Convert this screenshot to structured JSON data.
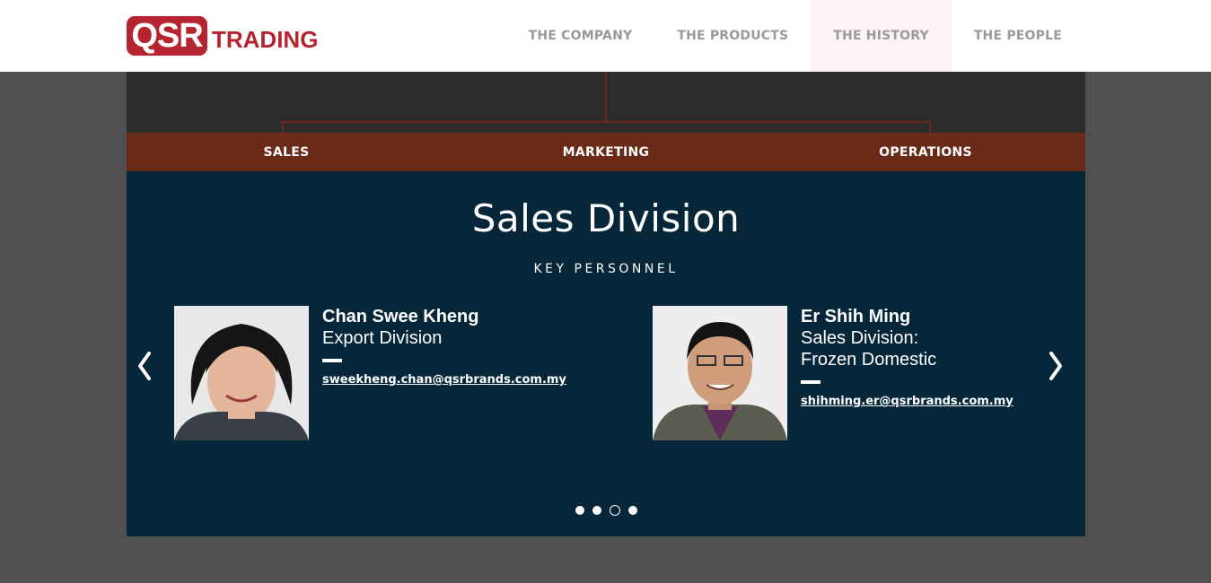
{
  "brand": {
    "logo_box": "QSR",
    "logo_text": "TRADING"
  },
  "nav": {
    "items": [
      {
        "label": "THE COMPANY"
      },
      {
        "label": "THE PRODUCTS"
      },
      {
        "label": "THE HISTORY"
      },
      {
        "label": "THE PEOPLE"
      }
    ]
  },
  "tabs": [
    {
      "label": "SALES"
    },
    {
      "label": "MARKETING"
    },
    {
      "label": "OPERATIONS"
    }
  ],
  "division": {
    "title": "Sales Division",
    "subtitle": "KEY PERSONNEL",
    "people": [
      {
        "name": "Chan Swee Kheng",
        "role": "Export Division",
        "email": "sweekheng.chan@qsrbrands.com.my"
      },
      {
        "name": "Er Shih Ming",
        "role": "Sales Division:\nFrozen Domestic",
        "email": "shihming.er@qsrbrands.com.my"
      }
    ]
  },
  "carousel": {
    "page_count": 4,
    "current_page": 3
  },
  "colors": {
    "brand_red": "#b5242f",
    "tab_bar": "#692b17",
    "panel_bg": "#06263a",
    "tree_bg": "#2c2c2c",
    "connector": "#6b2a14"
  }
}
